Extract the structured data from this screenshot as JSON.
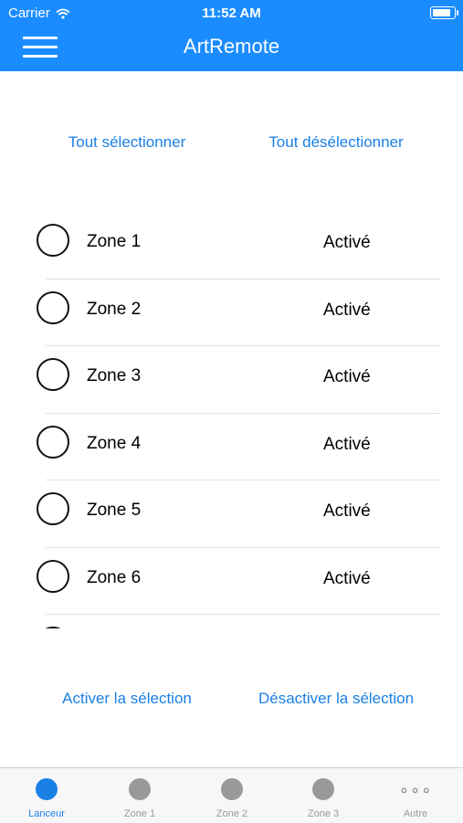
{
  "status_bar": {
    "carrier": "Carrier",
    "time": "11:52 AM",
    "battery_level": 0.95
  },
  "header": {
    "title": "ArtRemote"
  },
  "selection": {
    "select_all": "Tout sélectionner",
    "deselect_all": "Tout désélectionner"
  },
  "zones": [
    {
      "name": "Zone 1",
      "status": "Activé"
    },
    {
      "name": "Zone 2",
      "status": "Activé"
    },
    {
      "name": "Zone 3",
      "status": "Activé"
    },
    {
      "name": "Zone 4",
      "status": "Activé"
    },
    {
      "name": "Zone 5",
      "status": "Activé"
    },
    {
      "name": "Zone 6",
      "status": "Activé"
    }
  ],
  "actions": {
    "activate": "Activer la sélection",
    "deactivate": "Désactiver la sélection"
  },
  "tabbar": {
    "tabs": [
      {
        "label": "Lanceur"
      },
      {
        "label": "Zone 1"
      },
      {
        "label": "Zone 2"
      },
      {
        "label": "Zone 3"
      },
      {
        "label": "Autre"
      }
    ],
    "more_glyph": "∘∘∘"
  },
  "colors": {
    "header": "#1a8cff",
    "accent": "#1a80e6"
  }
}
